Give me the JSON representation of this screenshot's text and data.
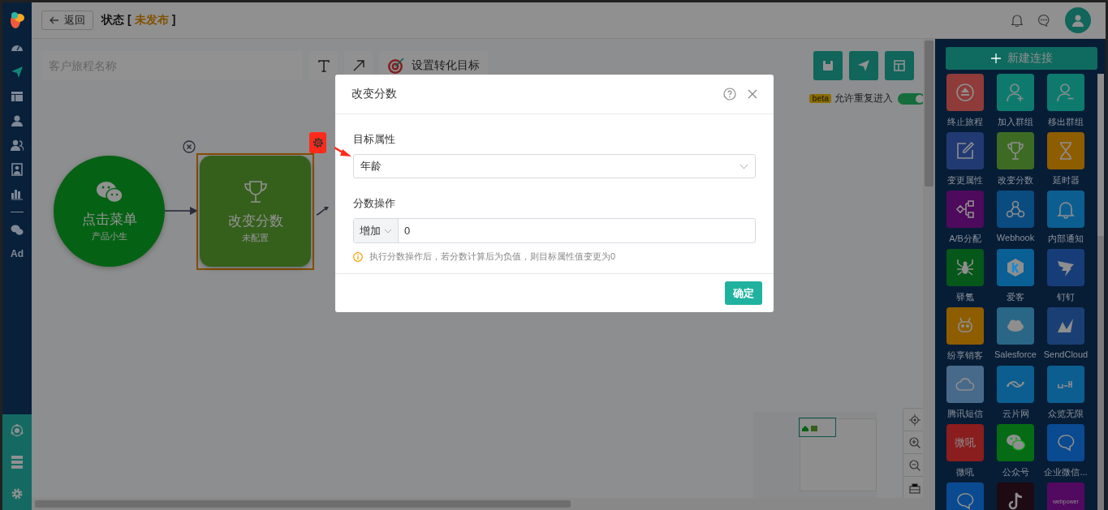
{
  "nav": {
    "items": [
      {
        "kind": "icon",
        "selected": false
      },
      {
        "kind": "icon",
        "selected": true
      },
      {
        "kind": "icon",
        "selected": false
      },
      {
        "kind": "icon",
        "selected": false
      },
      {
        "kind": "icon",
        "selected": false
      },
      {
        "kind": "icon",
        "selected": false
      },
      {
        "kind": "icon",
        "selected": false
      },
      {
        "kind": "divider",
        "selected": false
      },
      {
        "kind": "icon",
        "selected": false
      },
      {
        "kind": "text",
        "label": "Ad",
        "selected": false
      }
    ]
  },
  "header": {
    "back": "返回",
    "title": "状态",
    "status_open": "[",
    "status": "未发布",
    "status_close": "]"
  },
  "toolbar": {
    "placeholder": "客户旅程名称",
    "goal_button": "设置转化目标"
  },
  "repeat": {
    "badge": "beta",
    "label": "允许重复进入",
    "on": true
  },
  "flow": {
    "nodes": [
      {
        "kind": "trigger",
        "title": "点击菜单",
        "subtitle": "产品小生",
        "selected": false
      },
      {
        "kind": "action",
        "title": "改变分数",
        "subtitle": "未配置",
        "selected": true
      }
    ]
  },
  "panel": {
    "new_button": "新建连接",
    "tiles": [
      {
        "label": "终止旅程",
        "color": "#8e3b39"
      },
      {
        "label": "加入群组",
        "color": "#0e7a6e"
      },
      {
        "label": "移出群组",
        "color": "#0e7a6e"
      },
      {
        "label": "变更属性",
        "color": "#213a73"
      },
      {
        "label": "改变分数",
        "color": "#3d6b23"
      },
      {
        "label": "延时器",
        "color": "#8d5d00"
      },
      {
        "label": "A/B分配",
        "color": "#4e0a5c"
      },
      {
        "label": "Webhook",
        "color": "#0a4b80"
      },
      {
        "label": "内部通知",
        "color": "#0d5e90"
      },
      {
        "label": "驿氪",
        "color": "#05571a"
      },
      {
        "label": "爱客",
        "color": "#0a5f94"
      },
      {
        "label": "钉钉",
        "color": "#173d79"
      },
      {
        "label": "纷享销客",
        "color": "#8d5d00"
      },
      {
        "label": "Salesforce",
        "color": "#2a6686"
      },
      {
        "label": "SendCloud",
        "color": "#1a3f74"
      },
      {
        "label": "腾讯短信",
        "color": "#476a8a"
      },
      {
        "label": "云片网",
        "color": "#0d5e90"
      },
      {
        "label": "众览无限",
        "color": "#0d5e90"
      },
      {
        "label": "微吼",
        "color": "#8a1d1d",
        "glyph": "微吼"
      },
      {
        "label": "公众号",
        "color": "#056b14"
      },
      {
        "label": "企业微信...",
        "color": "#0a4a90"
      },
      {
        "color": "#0a4a90"
      },
      {
        "color": "#1e0a12"
      },
      {
        "color": "#520a60",
        "glyph": "webpower"
      }
    ]
  },
  "modal": {
    "title": "改变分数",
    "target_label": "目标属性",
    "target_value": "年龄",
    "op_label": "分数操作",
    "op": "增加",
    "op_value": "0",
    "hint": "执行分数操作后，若分数计算后为负值，则目标属性值变更为0",
    "confirm": "确定"
  }
}
